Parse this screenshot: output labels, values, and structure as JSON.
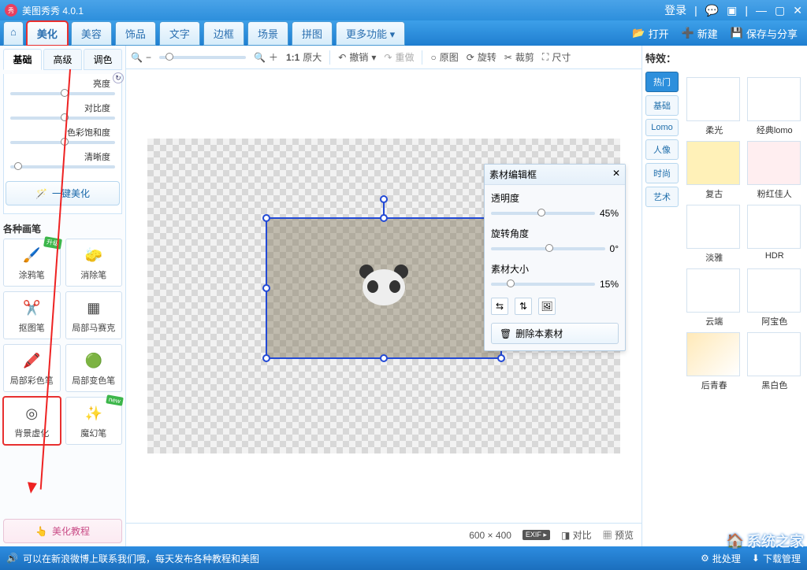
{
  "titlebar": {
    "app": "美图秀秀 4.0.1",
    "login": "登录"
  },
  "mainTabs": {
    "home_glyph": "⌂",
    "items": [
      "美化",
      "美容",
      "饰品",
      "文字",
      "边框",
      "场景",
      "拼图",
      "更多功能 ▾"
    ],
    "activeIndex": 0
  },
  "actions": {
    "open": "打开",
    "new": "新建",
    "save": "保存与分享"
  },
  "leftTabs": {
    "items": [
      "基础",
      "高级",
      "调色"
    ],
    "activeIndex": 0
  },
  "sliders": {
    "brightness": "亮度",
    "contrast": "对比度",
    "saturation": "色彩饱和度",
    "sharpness": "清晰度"
  },
  "onekey": "一键美化",
  "brushesTitle": "各种画笔",
  "brushes": [
    {
      "label": "涂鸦笔",
      "ico": "🖌️",
      "bg": "#fff"
    },
    {
      "label": "消除笔",
      "ico": "◧",
      "bg": "#fff"
    },
    {
      "label": "抠图笔",
      "ico": "✂️",
      "bg": "#fff"
    },
    {
      "label": "局部马赛克",
      "ico": "▦",
      "bg": "#fff"
    },
    {
      "label": "局部彩色笔",
      "ico": "🖍️",
      "bg": "#fff"
    },
    {
      "label": "局部变色笔",
      "ico": "🟢",
      "bg": "#fff"
    },
    {
      "label": "背景虚化",
      "ico": "◎",
      "bg": "#fff"
    },
    {
      "label": "魔幻笔",
      "ico": "✨",
      "bg": "#fff"
    }
  ],
  "guide": "美化教程",
  "toolbar": {
    "zoomOut": "−",
    "zoomIn": "＋",
    "ratio": "1:1",
    "orig": "原大",
    "undo": "撤销",
    "redo": "重做",
    "original": "原图",
    "rotate": "旋转",
    "crop": "裁剪",
    "size": "尺寸"
  },
  "materialPanel": {
    "title": "素材编辑框",
    "opacity_label": "透明度",
    "opacity_val": "45%",
    "rotate_label": "旋转角度",
    "rotate_val": "0°",
    "size_label": "素材大小",
    "size_val": "15%",
    "delete": "删除本素材"
  },
  "canvasStatus": {
    "dims": "600 × 400",
    "exif": "EXIF ▸",
    "compare": "对比",
    "preview": "预览"
  },
  "fx": {
    "header": "特效：",
    "cats": [
      "热门",
      "基础",
      "Lomo",
      "人像",
      "时尚",
      "艺术"
    ],
    "activeCat": 0,
    "items": [
      {
        "label": "柔光",
        "c": "#ffffff"
      },
      {
        "label": "经典lomo",
        "c": "#ffffff"
      },
      {
        "label": "复古",
        "c": "#fff1b8"
      },
      {
        "label": "粉红佳人",
        "c": "#ffeef0"
      },
      {
        "label": "淡雅",
        "c": "#ffffff"
      },
      {
        "label": "HDR",
        "c": "#ffffff"
      },
      {
        "label": "云端",
        "c": "#ffffff"
      },
      {
        "label": "阿宝色",
        "c": "#ffffff"
      },
      {
        "label": "后青春",
        "c": "#fff1d8"
      },
      {
        "label": "黑白色",
        "c": "#ffffff"
      }
    ]
  },
  "status": {
    "msg": "可以在新浪微博上联系我们哦，每天发布各种教程和美图",
    "batch": "批处理",
    "dlmgr": "下载管理"
  },
  "watermark": "系统之家"
}
